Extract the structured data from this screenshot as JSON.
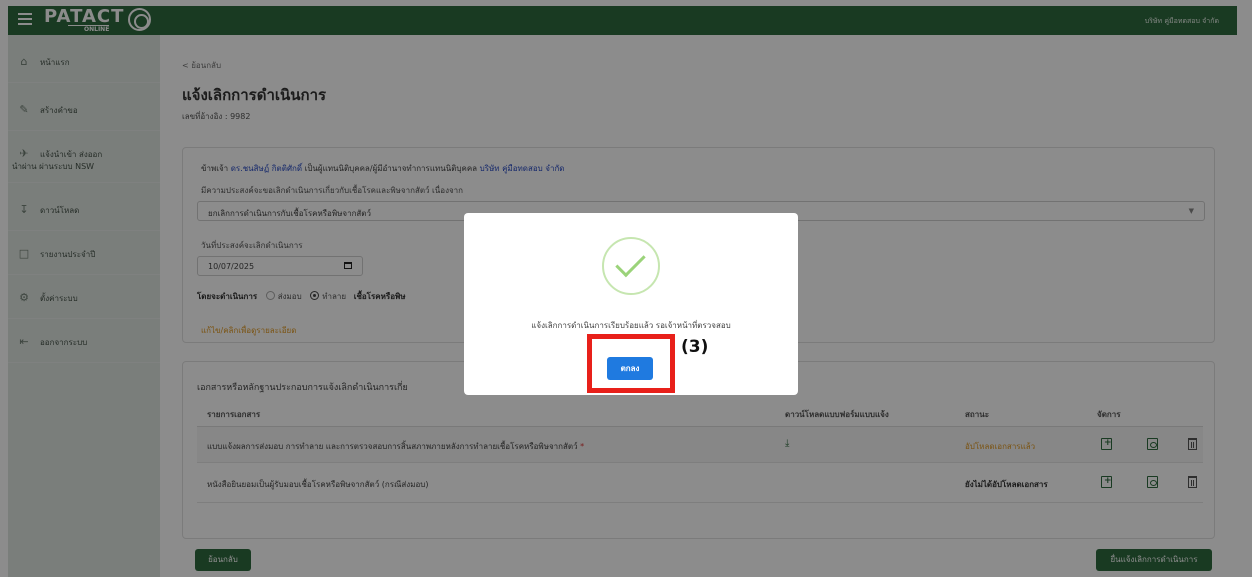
{
  "app": {
    "logo_text": "PATACT",
    "logo_sub": "ONLINE",
    "company_top": "บริษัท คู่มือทดสอบ จำกัด"
  },
  "sidebar": {
    "items": [
      {
        "label": "หน้าแรก",
        "icon": "home-icon"
      },
      {
        "label": "สร้างคำขอ",
        "icon": "pencil-icon"
      },
      {
        "label": "แจ้งนำเข้า ส่งออก",
        "label2": "นำผ่าน ผ่านระบบ NSW",
        "icon": "plane-icon"
      },
      {
        "label": "ดาวน์โหลด",
        "icon": "download-icon"
      },
      {
        "label": "รายงานประจำปี",
        "icon": "file-icon"
      },
      {
        "label": "ตั้งค่าระบบ",
        "icon": "gears-icon"
      },
      {
        "label": "ออกจากระบบ",
        "icon": "logout-icon"
      }
    ]
  },
  "main": {
    "back_link": "< ย้อนกลับ",
    "title": "แจ้งเลิกการดำเนินการ",
    "ref_no": "เลขที่อ้างอิง : 9982",
    "declare": {
      "prefix": "ข้าพเจ้า ",
      "person": "ดร.ชนสิษฏ์ กิตติศักดิ์",
      "middle": " เป็นผู้แทนนิติบุคคล/ผู้มีอำนาจทำการแทนนิติบุคคล ",
      "company": "บริษัท คู่มือทดสอบ จำกัด"
    },
    "purpose_label": "มีความประสงค์จะขอเลิกดำเนินการเกี่ยวกับเชื้อโรคและพิษจากสัตว์ เนื่องจาก",
    "purpose_value": "ยกเลิกการดำเนินการกับเชื้อโรคหรือพิษจากสัตว์",
    "date_label": "วันที่ประสงค์จะเลิกดำเนินการ",
    "date_value": "10/07/2025",
    "method_label": "โดยจะดำเนินการ",
    "method_opt1": "ส่งมอบ",
    "method_opt2": "ทำลาย",
    "pathogen_label": "เชื้อโรคหรือพิษ",
    "edit_link": "แก้ไข/คลิกเพื่อดูรายละเอียด"
  },
  "docs": {
    "title": "เอกสารหรือหลักฐานประกอบการแจ้งเลิกดำเนินการเกี่ย",
    "columns": [
      "รายการเอกสาร",
      "ดาวน์โหลดแบบฟอร์มแบบแจ้ง",
      "สถานะ",
      "จัดการ"
    ],
    "rows": [
      {
        "name": "แบบแจ้งผลการส่งมอบ การทำลาย และการตรวจสอบการสิ้นสภาพภายหลังการทำลายเชื้อโรคหรือพิษจากสัตว์",
        "required": "*",
        "status": "อัปโหลดเอกสารแล้ว"
      },
      {
        "name": "หนังสือยินยอมเป็นผู้รับมอบเชื้อโรคหรือพิษจากสัตว์ (กรณีส่งมอบ)",
        "required": "",
        "status": "ยังไม่ได้อัปโหลดเอกสาร"
      }
    ]
  },
  "footer": {
    "back_button": "ย้อนกลับ",
    "submit_button": "ยื่นแจ้งเลิกการดำเนินการ"
  },
  "modal": {
    "message": "แจ้งเลิกการดำเนินการเรียบร้อยแล้ว รอเจ้าหน้าที่ตรวจสอบ",
    "ok_button": "ตกลง"
  },
  "annotation": {
    "step": "(3)"
  },
  "colors": {
    "brand_green": "#2f6b3f",
    "link_blue": "#2a4cc4",
    "orange": "#e09a25",
    "ok_blue": "#1f7ae0",
    "highlight_red": "#e8201a"
  }
}
